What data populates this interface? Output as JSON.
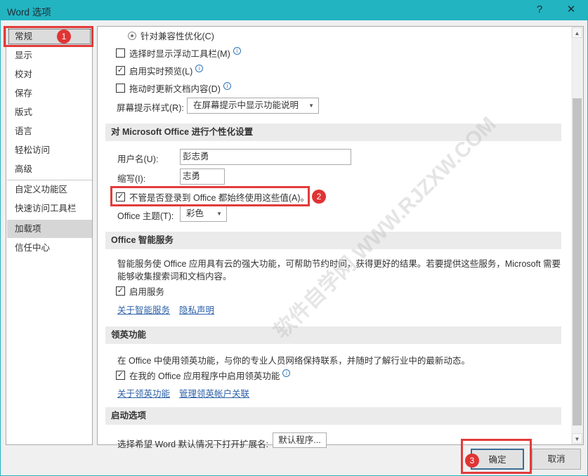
{
  "window": {
    "title": "Word 选项",
    "help": "?",
    "close": "✕"
  },
  "sidebar": {
    "items": [
      {
        "label": "常规"
      },
      {
        "label": "显示"
      },
      {
        "label": "校对"
      },
      {
        "label": "保存"
      },
      {
        "label": "版式"
      },
      {
        "label": "语言"
      },
      {
        "label": "轻松访问"
      },
      {
        "label": "高级"
      },
      {
        "label": "自定义功能区"
      },
      {
        "label": "快速访问工具栏"
      },
      {
        "label": "加载项"
      },
      {
        "label": "信任中心"
      }
    ],
    "selected": "常规"
  },
  "ui_options": {
    "compat_radio": "针对兼容性优化(C)",
    "mini_toolbar": "选择时显示浮动工具栏(M)",
    "live_preview": "启用实时预览(L)",
    "update_drag": "拖动时更新文档内容(D)",
    "screentip_label": "屏幕提示样式(R):",
    "screentip_value": "在屏幕提示中显示功能说明"
  },
  "personalize": {
    "header": "对 Microsoft Office 进行个性化设置",
    "username_label": "用户名(U):",
    "username_value": "彭志勇",
    "initials_label": "缩写(I):",
    "initials_value": "志勇",
    "always_use": "不管是否登录到 Office 都始终使用这些值(A)。",
    "theme_label": "Office 主题(T):",
    "theme_value": "彩色"
  },
  "intelligent": {
    "header": "Office 智能服务",
    "description": "智能服务使 Office 应用具有云的强大功能，可帮助节约时间，获得更好的结果。若要提供这些服务，Microsoft 需要能够收集搜索词和文档内容。",
    "enable": "启用服务",
    "link_about": "关于智能服务",
    "link_privacy": "隐私声明"
  },
  "linkedin": {
    "header": "领英功能",
    "description": "在 Office 中使用领英功能，与你的专业人员网络保持联系，并随时了解行业中的最新动态。",
    "enable": "在我的 Office 应用程序中启用领英功能",
    "link_about": "关于领英功能",
    "link_manage": "管理领英帐户关联"
  },
  "startup": {
    "header": "启动选项",
    "extensions_label": "选择希望 Word 默认情况下打开扩展名:",
    "default_programs": "默认程序..."
  },
  "buttons": {
    "ok": "确定",
    "cancel": "取消"
  },
  "annotations": {
    "1": "1",
    "2": "2",
    "3": "3"
  },
  "watermark": "软件自学网 WWW.RJZXW.COM",
  "colors": {
    "titlebar": "#22b4c1",
    "annotation": "#e23b3b"
  }
}
